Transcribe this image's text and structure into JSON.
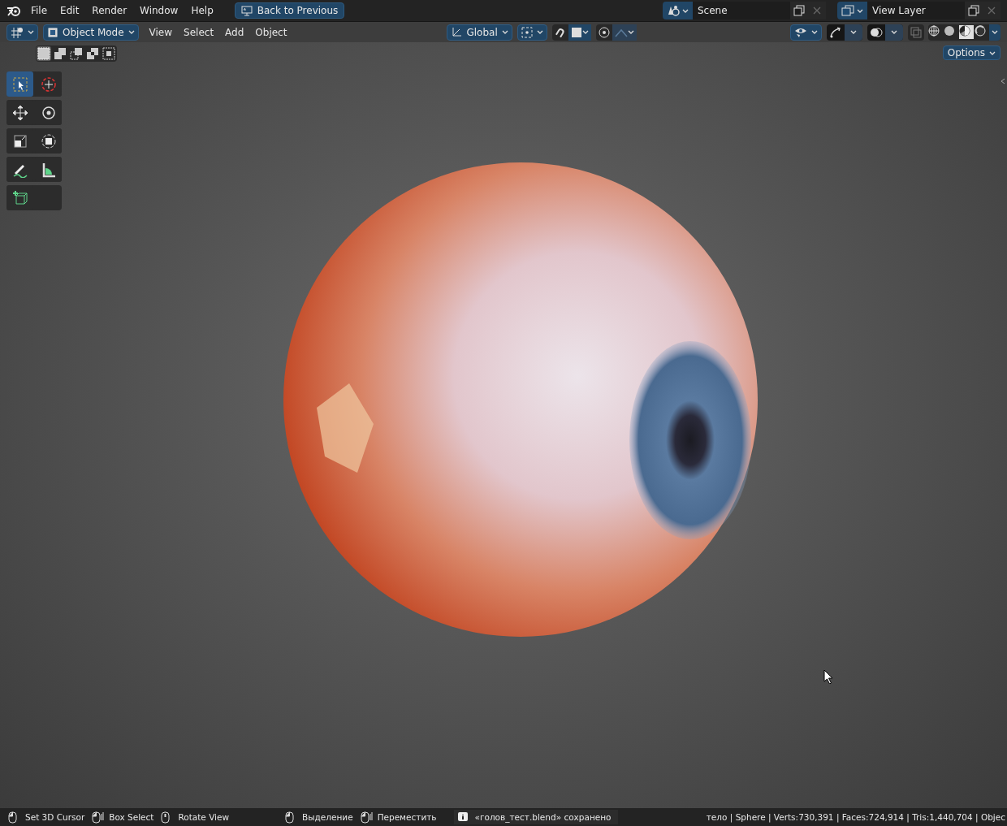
{
  "topbar": {
    "menus": [
      {
        "label": "File"
      },
      {
        "label": "Edit"
      },
      {
        "label": "Render"
      },
      {
        "label": "Window"
      },
      {
        "label": "Help"
      }
    ],
    "back_button": "Back to Previous",
    "scene": "Scene",
    "view_layer": "View Layer"
  },
  "header": {
    "mode": "Object Mode",
    "menus": [
      {
        "label": "View"
      },
      {
        "label": "Select"
      },
      {
        "label": "Add"
      },
      {
        "label": "Object"
      }
    ],
    "orientation": "Global",
    "gizmos": {
      "on": true
    },
    "overlays": {
      "on": true
    },
    "shading_modes": [
      {
        "kind": "wireframe",
        "selected": false
      },
      {
        "kind": "solid",
        "selected": false
      },
      {
        "kind": "material",
        "selected": true
      },
      {
        "kind": "rendered",
        "selected": false
      }
    ]
  },
  "select_modes": [
    {
      "kind": "new",
      "selected": true
    },
    {
      "kind": "extend",
      "selected": false
    },
    {
      "kind": "subtract",
      "selected": false
    },
    {
      "kind": "invert",
      "selected": false
    },
    {
      "kind": "intersect",
      "selected": false
    }
  ],
  "tool_groups": [
    {
      "tools": [
        {
          "kind": "select-box",
          "selected": true
        },
        {
          "kind": "cursor",
          "selected": false
        }
      ]
    },
    {
      "tools": [
        {
          "kind": "move",
          "selected": false
        },
        {
          "kind": "rotate",
          "selected": false
        }
      ]
    },
    {
      "tools": [
        {
          "kind": "scale",
          "selected": false
        },
        {
          "kind": "transform",
          "selected": false
        }
      ]
    },
    {
      "tools": [
        {
          "kind": "annotate",
          "selected": false
        },
        {
          "kind": "measure",
          "selected": false
        }
      ]
    },
    {
      "tools": [
        {
          "kind": "add-cube",
          "selected": false
        }
      ]
    }
  ],
  "options_button": "Options",
  "status_bar": {
    "hints": [
      {
        "kind": "left",
        "label": "Set 3D Cursor"
      },
      {
        "kind": "drag",
        "label": "Box Select"
      },
      {
        "kind": "middle",
        "label": "Rotate View"
      },
      {
        "kind": "left",
        "label": "Выделение"
      },
      {
        "kind": "drag",
        "label": "Переместить"
      }
    ],
    "message": "«голов_тест.blend» сохранено",
    "stats": "тело | Sphere | Verts:730,391 | Faces:724,914 | Tris:1,440,704 | Objec"
  }
}
